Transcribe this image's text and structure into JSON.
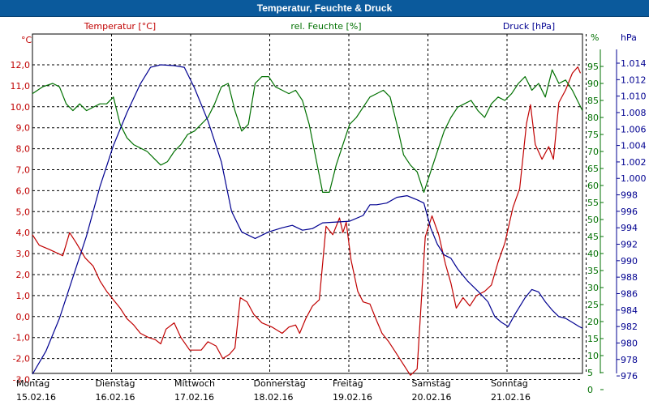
{
  "window": {
    "title": "Temperatur, Feuchte & Druck"
  },
  "chart_data": {
    "type": "line",
    "title": "Temperatur, Feuchte & Druck",
    "x_categories": [
      {
        "day": "Montag",
        "date": "15.02.16"
      },
      {
        "day": "Dienstag",
        "date": "16.02.16"
      },
      {
        "day": "Mittwoch",
        "date": "17.02.16"
      },
      {
        "day": "Donnerstag",
        "date": "18.02.16"
      },
      {
        "day": "Freitag",
        "date": "19.02.16"
      },
      {
        "day": "Samstag",
        "date": "20.02.16"
      },
      {
        "day": "Sonntag",
        "date": "21.02.16"
      }
    ],
    "x_range_days": [
      0,
      7
    ],
    "grid": true,
    "axes": {
      "left": {
        "unit": "°C",
        "label": "Temperatur [°C]",
        "color": "#c00000",
        "min": -3,
        "max": 12,
        "ticks": [
          "12,0",
          "11,0",
          "10,0",
          "9,0",
          "8,0",
          "7,0",
          "6,0",
          "5,0",
          "4,0",
          "3,0",
          "2,0",
          "1,0",
          "0,0",
          "-1,0",
          "-2,0",
          "-3,0"
        ]
      },
      "middle": {
        "unit": "%",
        "label": "rel. Feuchte [%]",
        "color": "#007000",
        "min": 0,
        "max": 95,
        "ticks": [
          "95",
          "90",
          "85",
          "80",
          "75",
          "70",
          "65",
          "60",
          "55",
          "50",
          "45",
          "40",
          "35",
          "30",
          "25",
          "20",
          "15",
          "10",
          "5",
          "0"
        ]
      },
      "right": {
        "unit": "hPa",
        "label": "Druck [hPa]",
        "color": "#000090",
        "min": 976,
        "max": 1014,
        "ticks": [
          "1.014",
          "1.012",
          "1.010",
          "1.008",
          "1.006",
          "1.004",
          "1.002",
          "1.000",
          "998",
          "996",
          "994",
          "992",
          "990",
          "988",
          "986",
          "984",
          "982",
          "980",
          "978",
          "976"
        ]
      }
    },
    "series": [
      {
        "name": "Temperatur [°C]",
        "axis": "left",
        "color": "#c00000",
        "points": [
          [
            0,
            3.9
          ],
          [
            0.1,
            3.4
          ],
          [
            0.25,
            3.2
          ],
          [
            0.45,
            2.9
          ],
          [
            0.55,
            4.0
          ],
          [
            0.65,
            3.5
          ],
          [
            0.78,
            2.8
          ],
          [
            0.9,
            2.4
          ],
          [
            1.0,
            1.7
          ],
          [
            1.1,
            1.2
          ],
          [
            1.2,
            0.8
          ],
          [
            1.3,
            0.4
          ],
          [
            1.4,
            -0.1
          ],
          [
            1.5,
            -0.4
          ],
          [
            1.6,
            -0.8
          ],
          [
            1.72,
            -1.0
          ],
          [
            1.82,
            -1.1
          ],
          [
            1.9,
            -1.3
          ],
          [
            1.98,
            -0.6
          ],
          [
            2.1,
            -0.3
          ],
          [
            2.2,
            -1.0
          ],
          [
            2.33,
            -1.6
          ],
          [
            2.5,
            -1.6
          ],
          [
            2.6,
            -1.2
          ],
          [
            2.72,
            -1.4
          ],
          [
            2.82,
            -2.0
          ],
          [
            2.92,
            -1.8
          ],
          [
            3.0,
            -1.5
          ],
          [
            3.08,
            0.9
          ],
          [
            3.18,
            0.7
          ],
          [
            3.28,
            0.1
          ],
          [
            3.4,
            -0.3
          ],
          [
            3.55,
            -0.5
          ],
          [
            3.7,
            -0.8
          ],
          [
            3.8,
            -0.5
          ],
          [
            3.9,
            -0.4
          ],
          [
            3.96,
            -0.8
          ],
          [
            4.05,
            -0.1
          ],
          [
            4.15,
            0.5
          ],
          [
            4.25,
            0.8
          ],
          [
            4.35,
            4.3
          ],
          [
            4.45,
            3.9
          ],
          [
            4.55,
            4.7
          ],
          [
            4.6,
            4.0
          ],
          [
            4.65,
            4.5
          ],
          [
            4.72,
            2.7
          ],
          [
            4.82,
            1.2
          ],
          [
            4.9,
            0.7
          ],
          [
            5.0,
            0.6
          ],
          [
            5.1,
            -0.2
          ],
          [
            5.18,
            -0.8
          ],
          [
            5.28,
            -1.2
          ],
          [
            5.38,
            -1.7
          ],
          [
            5.48,
            -2.2
          ],
          [
            5.6,
            -2.8
          ],
          [
            5.7,
            -2.5
          ],
          [
            5.82,
            3.8
          ],
          [
            5.92,
            4.8
          ],
          [
            6.02,
            3.9
          ],
          [
            6.12,
            2.5
          ],
          [
            6.2,
            1.6
          ],
          [
            6.28,
            0.4
          ],
          [
            6.38,
            0.9
          ],
          [
            6.48,
            0.5
          ],
          [
            6.58,
            1.0
          ],
          [
            6.7,
            1.2
          ],
          [
            6.8,
            1.5
          ],
          [
            6.9,
            2.6
          ],
          [
            7.0,
            3.5
          ],
          [
            7.12,
            5.2
          ],
          [
            7.22,
            6.1
          ],
          [
            7.32,
            9.2
          ],
          [
            7.38,
            10.1
          ],
          [
            7.45,
            8.2
          ],
          [
            7.55,
            7.5
          ],
          [
            7.65,
            8.1
          ],
          [
            7.72,
            7.5
          ],
          [
            7.8,
            10.2
          ],
          [
            7.9,
            10.8
          ],
          [
            8.0,
            11.6
          ],
          [
            8.08,
            11.9
          ],
          [
            8.12,
            11.6
          ]
        ]
      },
      {
        "name": "rel. Feuchte [%]",
        "axis": "middle",
        "color": "#007000",
        "points": [
          [
            0,
            87
          ],
          [
            0.15,
            89
          ],
          [
            0.3,
            90
          ],
          [
            0.4,
            89
          ],
          [
            0.5,
            84
          ],
          [
            0.6,
            82
          ],
          [
            0.7,
            84
          ],
          [
            0.8,
            82
          ],
          [
            0.9,
            83
          ],
          [
            1.0,
            84
          ],
          [
            1.1,
            84
          ],
          [
            1.2,
            86
          ],
          [
            1.3,
            78
          ],
          [
            1.4,
            74
          ],
          [
            1.5,
            72
          ],
          [
            1.6,
            71
          ],
          [
            1.7,
            70
          ],
          [
            1.8,
            68
          ],
          [
            1.9,
            66
          ],
          [
            2.0,
            67
          ],
          [
            2.1,
            70
          ],
          [
            2.2,
            72
          ],
          [
            2.3,
            75
          ],
          [
            2.4,
            76
          ],
          [
            2.5,
            78
          ],
          [
            2.6,
            80
          ],
          [
            2.7,
            84
          ],
          [
            2.8,
            89
          ],
          [
            2.9,
            90
          ],
          [
            3.0,
            82
          ],
          [
            3.1,
            76
          ],
          [
            3.2,
            78
          ],
          [
            3.3,
            90
          ],
          [
            3.4,
            92
          ],
          [
            3.5,
            92
          ],
          [
            3.6,
            89
          ],
          [
            3.7,
            88
          ],
          [
            3.8,
            87
          ],
          [
            3.9,
            88
          ],
          [
            4.0,
            85
          ],
          [
            4.1,
            78
          ],
          [
            4.2,
            68
          ],
          [
            4.3,
            58
          ],
          [
            4.4,
            58
          ],
          [
            4.5,
            66
          ],
          [
            4.6,
            72
          ],
          [
            4.7,
            78
          ],
          [
            4.8,
            80
          ],
          [
            4.9,
            83
          ],
          [
            5.0,
            86
          ],
          [
            5.1,
            87
          ],
          [
            5.2,
            88
          ],
          [
            5.3,
            86
          ],
          [
            5.4,
            78
          ],
          [
            5.5,
            69
          ],
          [
            5.6,
            66
          ],
          [
            5.7,
            64
          ],
          [
            5.8,
            58
          ],
          [
            5.9,
            64
          ],
          [
            6.0,
            70
          ],
          [
            6.1,
            76
          ],
          [
            6.2,
            80
          ],
          [
            6.3,
            83
          ],
          [
            6.4,
            84
          ],
          [
            6.5,
            85
          ],
          [
            6.6,
            82
          ],
          [
            6.7,
            80
          ],
          [
            6.8,
            84
          ],
          [
            6.9,
            86
          ],
          [
            7.0,
            85
          ],
          [
            7.1,
            87
          ],
          [
            7.2,
            90
          ],
          [
            7.3,
            92
          ],
          [
            7.4,
            88
          ],
          [
            7.5,
            90
          ],
          [
            7.6,
            86
          ],
          [
            7.7,
            94
          ],
          [
            7.8,
            90
          ],
          [
            7.9,
            91
          ],
          [
            8.0,
            88
          ],
          [
            8.1,
            84
          ],
          [
            8.15,
            82
          ]
        ]
      },
      {
        "name": "Druck [hPa]",
        "axis": "right",
        "color": "#000090",
        "points": [
          [
            0,
            976.2
          ],
          [
            0.2,
            979.0
          ],
          [
            0.4,
            983.0
          ],
          [
            0.6,
            988.0
          ],
          [
            0.8,
            993.0
          ],
          [
            1.0,
            999.0
          ],
          [
            1.2,
            1004.0
          ],
          [
            1.4,
            1008.0
          ],
          [
            1.6,
            1011.5
          ],
          [
            1.75,
            1013.5
          ],
          [
            1.9,
            1013.8
          ],
          [
            2.1,
            1013.7
          ],
          [
            2.25,
            1013.5
          ],
          [
            2.4,
            1011.0
          ],
          [
            2.6,
            1007.0
          ],
          [
            2.8,
            1002.0
          ],
          [
            2.95,
            996.0
          ],
          [
            3.1,
            993.5
          ],
          [
            3.3,
            992.7
          ],
          [
            3.5,
            993.5
          ],
          [
            3.7,
            994.0
          ],
          [
            3.85,
            994.3
          ],
          [
            4.0,
            993.7
          ],
          [
            4.15,
            993.9
          ],
          [
            4.3,
            994.6
          ],
          [
            4.5,
            994.7
          ],
          [
            4.7,
            994.8
          ],
          [
            4.9,
            995.5
          ],
          [
            5.0,
            996.8
          ],
          [
            5.1,
            996.8
          ],
          [
            5.25,
            997.0
          ],
          [
            5.4,
            997.7
          ],
          [
            5.55,
            997.9
          ],
          [
            5.7,
            997.4
          ],
          [
            5.8,
            997.0
          ],
          [
            5.9,
            994.0
          ],
          [
            6.0,
            992.0
          ],
          [
            6.1,
            990.7
          ],
          [
            6.2,
            990.3
          ],
          [
            6.3,
            989.0
          ],
          [
            6.45,
            987.5
          ],
          [
            6.6,
            986.3
          ],
          [
            6.75,
            985.0
          ],
          [
            6.85,
            983.2
          ],
          [
            6.95,
            982.5
          ],
          [
            7.05,
            982.0
          ],
          [
            7.15,
            983.5
          ],
          [
            7.3,
            985.5
          ],
          [
            7.4,
            986.5
          ],
          [
            7.5,
            986.2
          ],
          [
            7.6,
            985.0
          ],
          [
            7.7,
            984.0
          ],
          [
            7.8,
            983.2
          ],
          [
            7.9,
            983.0
          ],
          [
            8.0,
            982.5
          ],
          [
            8.1,
            982.0
          ],
          [
            8.15,
            981.8
          ]
        ]
      }
    ]
  }
}
